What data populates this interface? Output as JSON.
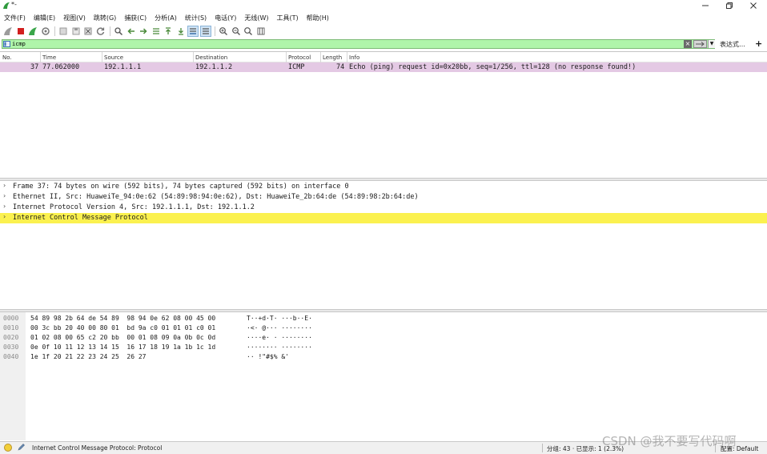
{
  "window": {
    "title": "*-",
    "controls": {
      "minimize_icon": "minimize-icon",
      "maximize_icon": "restore-icon",
      "close_icon": "close-icon"
    }
  },
  "menu": [
    "文件(F)",
    "编辑(E)",
    "视图(V)",
    "跳转(G)",
    "捕获(C)",
    "分析(A)",
    "统计(S)",
    "电话(Y)",
    "无线(W)",
    "工具(T)",
    "帮助(H)"
  ],
  "toolbar": {
    "icons": [
      "shark-fin-start-icon",
      "stop-square-icon",
      "restart-fin-icon",
      "capture-options-gear-icon",
      "open-file-icon",
      "save-file-icon",
      "close-file-icon",
      "reload-icon",
      "find-packet-icon",
      "go-back-icon",
      "go-forward-icon",
      "go-to-packet-icon",
      "go-first-icon",
      "go-last-icon",
      "auto-scroll-icon",
      "colorize-icon",
      "zoom-in-icon",
      "zoom-out-icon",
      "normal-size-icon",
      "resize-columns-icon"
    ]
  },
  "filter": {
    "value": "icmp",
    "expression_label": "表达式…",
    "add_label": "+",
    "color": "#aff5aa"
  },
  "packet_list": {
    "columns": [
      "No.",
      "Time",
      "Source",
      "Destination",
      "Protocol",
      "Length",
      "Info"
    ],
    "rows": [
      {
        "no": "37",
        "time": "77.062000",
        "source": "192.1.1.1",
        "destination": "192.1.1.2",
        "protocol": "ICMP",
        "length": "74",
        "info": "Echo (ping) request  id=0x20bb, seq=1/256, ttl=128 (no response found!)",
        "color": "#e4c9e4"
      }
    ]
  },
  "details": [
    {
      "text": "Frame 37: 74 bytes on wire (592 bits), 74 bytes captured (592 bits) on interface 0",
      "highlighted": false
    },
    {
      "text": "Ethernet II, Src: HuaweiTe_94:0e:62 (54:89:98:94:0e:62), Dst: HuaweiTe_2b:64:de (54:89:98:2b:64:de)",
      "highlighted": false
    },
    {
      "text": "Internet Protocol Version 4, Src: 192.1.1.1, Dst: 192.1.1.2",
      "highlighted": false
    },
    {
      "text": "Internet Control Message Protocol",
      "highlighted": true,
      "color": "#fbf14f"
    }
  ],
  "bytes": [
    {
      "offset": "0000",
      "hex": "54 89 98 2b 64 de 54 89  98 94 0e 62 08 00 45 00",
      "ascii": "T··+d·T· ···b··E·"
    },
    {
      "offset": "0010",
      "hex": "00 3c bb 20 40 00 80 01  bd 9a c0 01 01 01 c0 01",
      "ascii": "·<· @··· ········"
    },
    {
      "offset": "0020",
      "hex": "01 02 08 00 65 c2 20 bb  00 01 08 09 0a 0b 0c 0d",
      "ascii": "····e· · ········"
    },
    {
      "offset": "0030",
      "hex": "0e 0f 10 11 12 13 14 15  16 17 18 19 1a 1b 1c 1d",
      "ascii": "········ ········"
    },
    {
      "offset": "0040",
      "hex": "1e 1f 20 21 22 23 24 25  26 27",
      "ascii": "·· !\"#$% &'"
    }
  ],
  "status": {
    "text": "Internet Control Message Protocol: Protocol",
    "packets": "分组: 43 · 已显示: 1 (2.3%)",
    "profile": "配置: Default",
    "watermark": "CSDN @我不要写代码啊"
  }
}
